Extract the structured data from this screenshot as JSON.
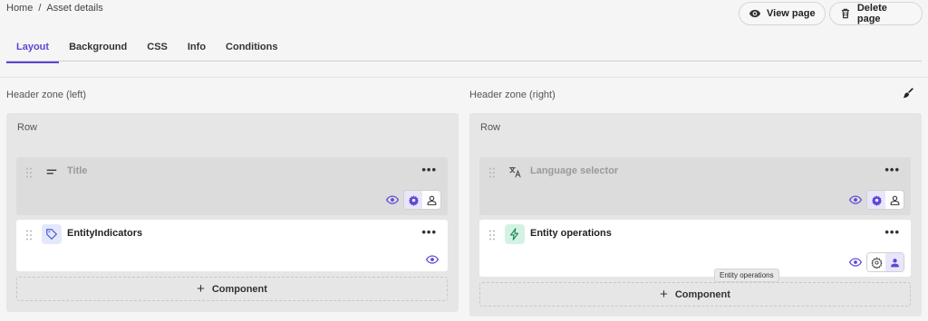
{
  "breadcrumb": {
    "home": "Home",
    "separator": "/",
    "current": "Asset details"
  },
  "actions": {
    "view_page": "View page",
    "delete_page": "Delete page"
  },
  "tabs": [
    "Layout",
    "Background",
    "CSS",
    "Info",
    "Conditions"
  ],
  "active_tab": "Layout",
  "zones": {
    "left": {
      "label": "Header zone (left)",
      "row_label": "Row",
      "components": [
        {
          "title": "Title",
          "icon": "text-lines-icon",
          "muted": true
        },
        {
          "title": "EntityIndicators",
          "icon": "tag-icon",
          "muted": false
        }
      ],
      "add_label": "Component"
    },
    "right": {
      "label": "Header zone (right)",
      "row_label": "Row",
      "components": [
        {
          "title": "Language selector",
          "icon": "translate-icon",
          "muted": true
        },
        {
          "title": "Entity operations",
          "icon": "bolt-icon",
          "muted": false
        }
      ],
      "add_label": "Component"
    }
  },
  "more_label": "•••",
  "tooltip": "Entity operations",
  "colors": {
    "accent": "#5b47d6",
    "tag_bg": "#e3e8fb",
    "bolt_bg": "#d3f2e3"
  }
}
